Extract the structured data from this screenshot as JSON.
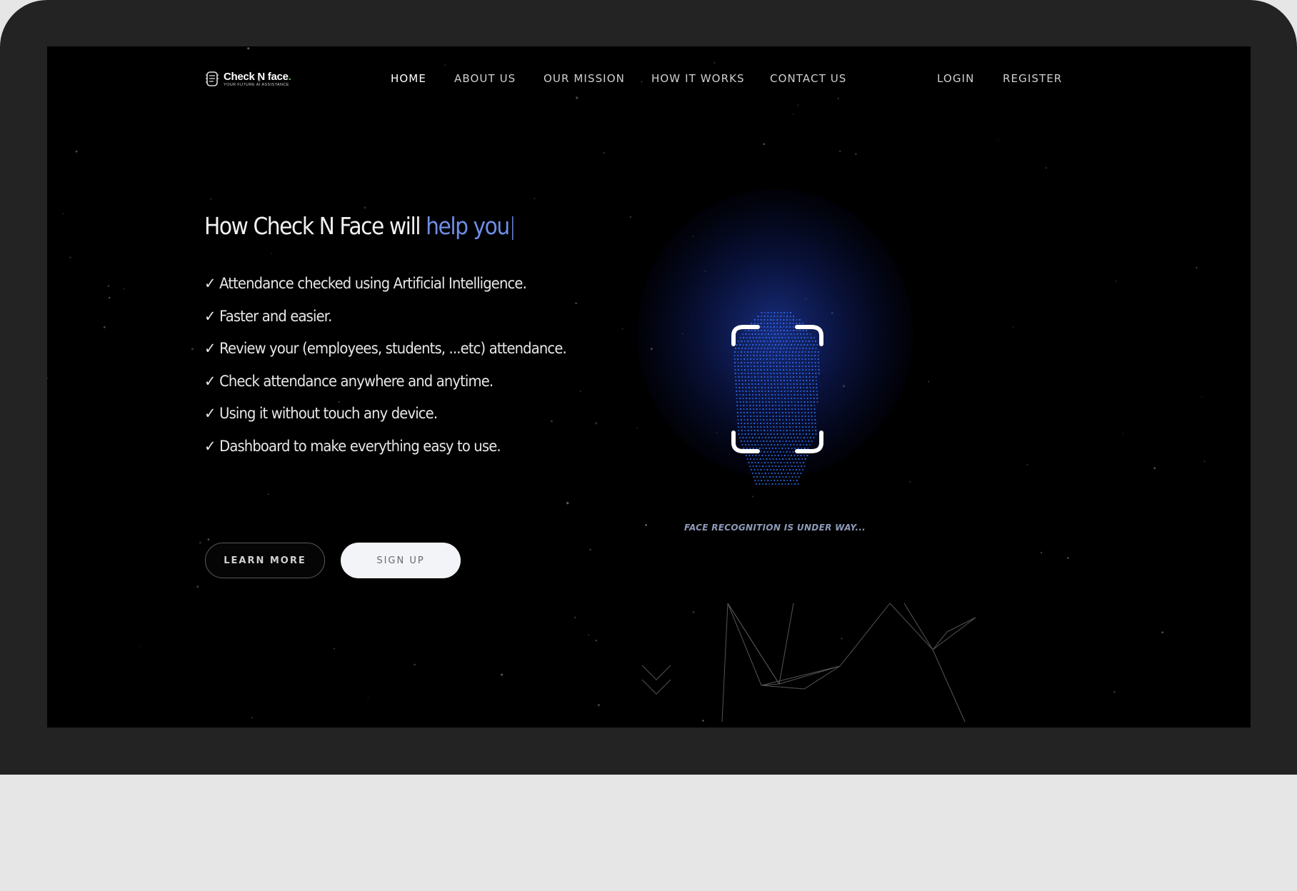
{
  "brand": {
    "name": "Check N face",
    "tagline": "YOUR FUTURE AI ASSISTANCE",
    "accent_color": "#6ac36a"
  },
  "nav": {
    "items": [
      {
        "label": "HOME",
        "active": true
      },
      {
        "label": "ABOUT US",
        "active": false
      },
      {
        "label": "OUR MISSION",
        "active": false
      },
      {
        "label": "HOW IT WORKS",
        "active": false
      },
      {
        "label": "CONTACT US",
        "active": false
      }
    ],
    "auth": [
      {
        "label": "LOGIN"
      },
      {
        "label": "REGISTER"
      }
    ]
  },
  "hero": {
    "title_prefix": "How Check N Face will ",
    "title_highlight": "help you",
    "title_cursor": "|",
    "highlight_color": "#6f8ee6",
    "check_mark": "✓",
    "features": [
      "Attendance checked using Artificial Intelligence.",
      "Faster and easier.",
      "Review your (employees, students, ...etc) attendance.",
      "Check attendance anywhere and anytime.",
      "Using it without touch any device.",
      "Dashboard to make everything easy to use."
    ],
    "buttons": {
      "learn_more": "LEARN MORE",
      "sign_up": "SIGN UP"
    }
  },
  "face_scan": {
    "icon": "face-scan-icon",
    "status": "FACE RECOGNITION IS UNDER WAY..."
  },
  "colors": {
    "page_background": "#000000",
    "bezel": "#232323",
    "face_blue": "#2f6cf0"
  }
}
